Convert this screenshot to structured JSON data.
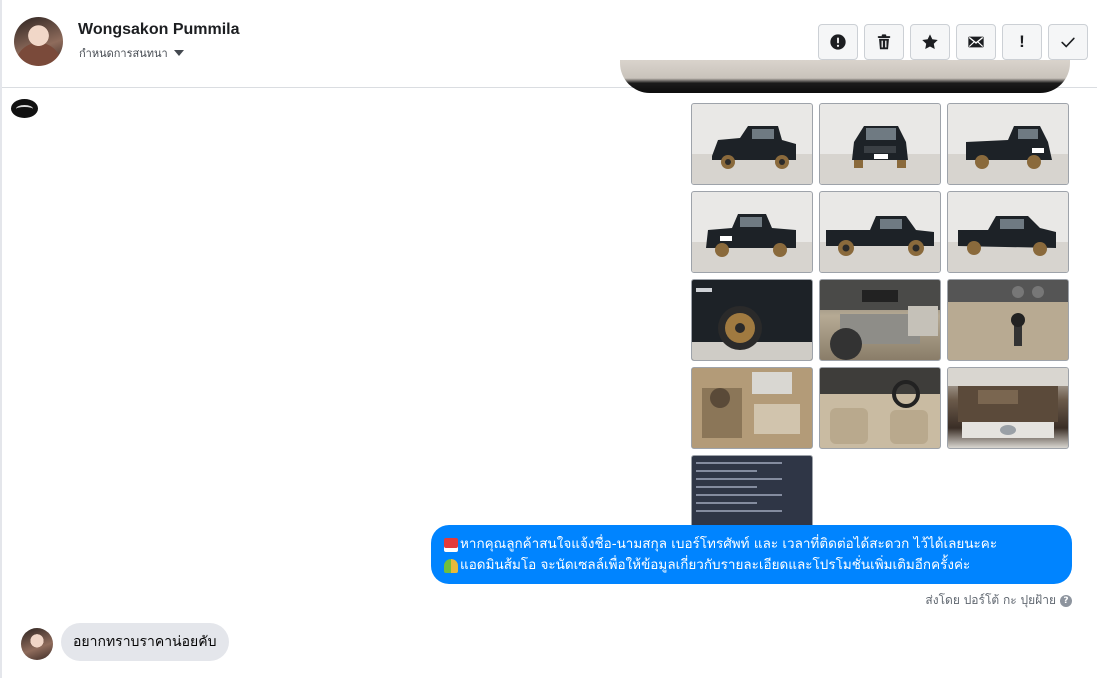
{
  "header": {
    "contact_name": "Wongsakon Pummila",
    "assign_label": "กำหนดการสนทนา",
    "toolbar": [
      {
        "name": "mark-spam-button",
        "icon": "alert-circle-icon"
      },
      {
        "name": "delete-button",
        "icon": "trash-icon"
      },
      {
        "name": "star-button",
        "icon": "star-icon"
      },
      {
        "name": "mark-unread-button",
        "icon": "envelope-icon"
      },
      {
        "name": "important-button",
        "icon": "exclamation-icon",
        "glyph": "!"
      },
      {
        "name": "mark-done-button",
        "icon": "check-icon"
      }
    ]
  },
  "conversation": {
    "photos": [
      {
        "name": "photo-truck-front-left",
        "icon": "truck-photo",
        "style": "exterior"
      },
      {
        "name": "photo-truck-front",
        "icon": "truck-photo",
        "style": "exterior"
      },
      {
        "name": "photo-truck-rear-right",
        "icon": "truck-photo",
        "style": "exterior"
      },
      {
        "name": "photo-truck-rear-left",
        "icon": "truck-photo",
        "style": "exterior"
      },
      {
        "name": "photo-truck-side",
        "icon": "truck-photo",
        "style": "exterior"
      },
      {
        "name": "photo-truck-front-right",
        "icon": "truck-photo",
        "style": "exterior"
      },
      {
        "name": "photo-wheel-closeup",
        "icon": "wheel-photo",
        "style": "dark"
      },
      {
        "name": "photo-dashboard",
        "icon": "interior-photo",
        "style": "cabin"
      },
      {
        "name": "photo-gear-shift",
        "icon": "interior-photo",
        "style": "cabin"
      },
      {
        "name": "photo-rear-cabin",
        "icon": "interior-photo",
        "style": "cabin"
      },
      {
        "name": "photo-front-cabin",
        "icon": "interior-photo",
        "style": "cabin"
      },
      {
        "name": "photo-engine-bay",
        "icon": "engine-photo",
        "style": "engine"
      },
      {
        "name": "photo-spec-sheet",
        "icon": "document-photo",
        "style": "doc"
      }
    ],
    "outgoing_message": {
      "line1": "หากคุณลูกค้าสนใจแจ้งชื่อ-นามสกุล เบอร์โทรศัพท์ และ เวลาที่ติดต่อได้สะดวก ไว้ได้เลยนะคะ",
      "line2": "แอดมินส้มโอ จะนัดเซลล์เพื่อให้ข้อมูลเกี่ยวกับรายละเอียดและโปรโมชั่นเพิ่มเติมอีกครั้งค่ะ",
      "emoji1": "telephone-emoji",
      "emoji2": "people-emoji"
    },
    "sent_by": "ส่งโดย ปอร์โต้ กะ ปุยฝ้าย",
    "help_glyph": "?",
    "incoming_message": {
      "text": "อยากทราบราคาน่อยคับ"
    }
  },
  "colors": {
    "outgoing_bubble": "#0084ff",
    "incoming_bubble": "#e4e6eb",
    "toolbar_button_bg": "#f5f6f7"
  }
}
